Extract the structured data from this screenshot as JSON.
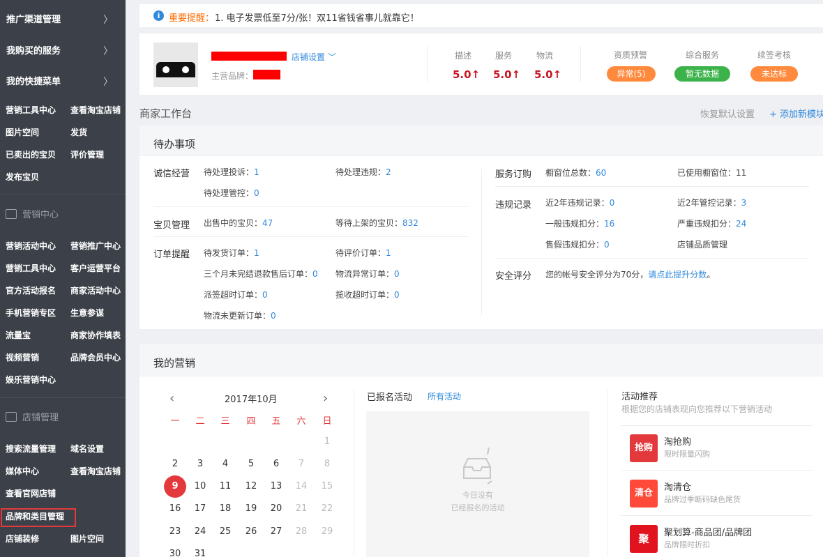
{
  "sidebar": {
    "headers": [
      "推广渠道管理",
      "我购买的服务",
      "我的快捷菜单"
    ],
    "quick_links": [
      "营销工具中心",
      "查看淘宝店铺",
      "图片空间",
      "发货",
      "已卖出的宝贝",
      "评价管理",
      "发布宝贝"
    ],
    "marketing_section": "营销中心",
    "marketing_links": [
      "营销活动中心",
      "营销推广中心",
      "营销工具中心",
      "客户运营平台",
      "官方活动报名",
      "商家活动中心",
      "手机营销专区",
      "生意参谋",
      "流量宝",
      "商家协作填表",
      "视频营销",
      "品牌会员中心",
      "娱乐营销中心"
    ],
    "shop_section": "店铺管理",
    "shop_links": [
      "搜索流量管理",
      "域名设置",
      "媒体中心",
      "查看淘宝店铺",
      "查看官网店铺",
      "品牌和类目管理",
      "店铺装修",
      "图片空间"
    ]
  },
  "notice": {
    "title": "重要提醒：",
    "text": "1. 电子发票低至7分/张！双11省钱省事儿就靠它！"
  },
  "shop": {
    "settings_label": "店铺设置",
    "brand_label": "主营品牌：",
    "ratings": [
      {
        "label": "描述",
        "value": "5.0↑"
      },
      {
        "label": "服务",
        "value": "5.0↑"
      },
      {
        "label": "物流",
        "value": "5.0↑"
      }
    ],
    "badges": [
      {
        "label": "资质预警",
        "value": "异常(5)",
        "color": "#ff8a3d"
      },
      {
        "label": "综合服务",
        "value": "暂无数据",
        "color": "#3cb34a"
      },
      {
        "label": "续签考核",
        "value": "未达标",
        "color": "#ff8a3d"
      }
    ]
  },
  "workbench": {
    "title": "商家工作台",
    "reset_label": "恢复默认设置",
    "add_label": "+ 添加新模块"
  },
  "todo": {
    "title": "待办事项",
    "integrity": {
      "label": "诚信经营",
      "complaints": "待处理投诉：",
      "complaints_val": "1",
      "violations": "待处理违规：",
      "violations_val": "2",
      "controls": "待处理管控：",
      "controls_val": "0"
    },
    "items": {
      "label": "宝贝管理",
      "on_sale": "出售中的宝贝：",
      "on_sale_val": "47",
      "pending": "等待上架的宝贝：",
      "pending_val": "832"
    },
    "orders": {
      "label": "订单提醒",
      "to_ship": "待发货订单：",
      "to_ship_val": "1",
      "to_review": "待评价订单：",
      "to_review_val": "1",
      "refund": "三个月未完结退款售后订单：",
      "refund_val": "0",
      "logistics_err": "物流异常订单：",
      "logistics_err_val": "0",
      "delivery_timeout": "派签超时订单：",
      "delivery_timeout_val": "0",
      "pickup_timeout": "揽收超时订单：",
      "pickup_timeout_val": "0",
      "not_updated": "物流未更新订单：",
      "not_updated_val": "0"
    },
    "service": {
      "label": "服务订购",
      "windows": "橱窗位总数：",
      "windows_val": "60",
      "used": "已使用橱窗位：",
      "used_val": "11"
    },
    "violation_rec": {
      "label": "违规记录",
      "r2y": "近2年违规记录：",
      "r2y_val": "0",
      "c2y": "近2年管控记录：",
      "c2y_val": "3",
      "general": "一般违规扣分：",
      "general_val": "16",
      "severe": "严重违规扣分：",
      "severe_val": "24",
      "fake": "售假违规扣分：",
      "fake_val": "0",
      "quality_link": "店铺品质管理"
    },
    "security": {
      "label": "安全评分",
      "text": "您的帐号安全评分为70分，",
      "link": "请点此提升分数",
      "end": "。"
    }
  },
  "marketing": {
    "title": "我的营销",
    "calendar": {
      "month": "2017年10月",
      "weekdays": [
        "一",
        "二",
        "三",
        "四",
        "五",
        "六",
        "日"
      ],
      "today": "9"
    },
    "registered": {
      "title": "已报名活动",
      "all_link": "所有活动",
      "empty_line1": "今日没有",
      "empty_line2": "已经报名的活动"
    },
    "recommend": {
      "title": "活动推荐",
      "subtitle": "根据您的店铺表现向您推荐以下营销活动",
      "items": [
        {
          "icon": "抢购",
          "title": "淘抢购",
          "sub": "限时限量闪购"
        },
        {
          "icon": "清仓",
          "title": "淘清仓",
          "sub": "品牌过季断码缺色尾货"
        },
        {
          "icon": "聚",
          "title": "聚划算-商品团/品牌团",
          "sub": "品牌限时折扣"
        }
      ]
    }
  }
}
